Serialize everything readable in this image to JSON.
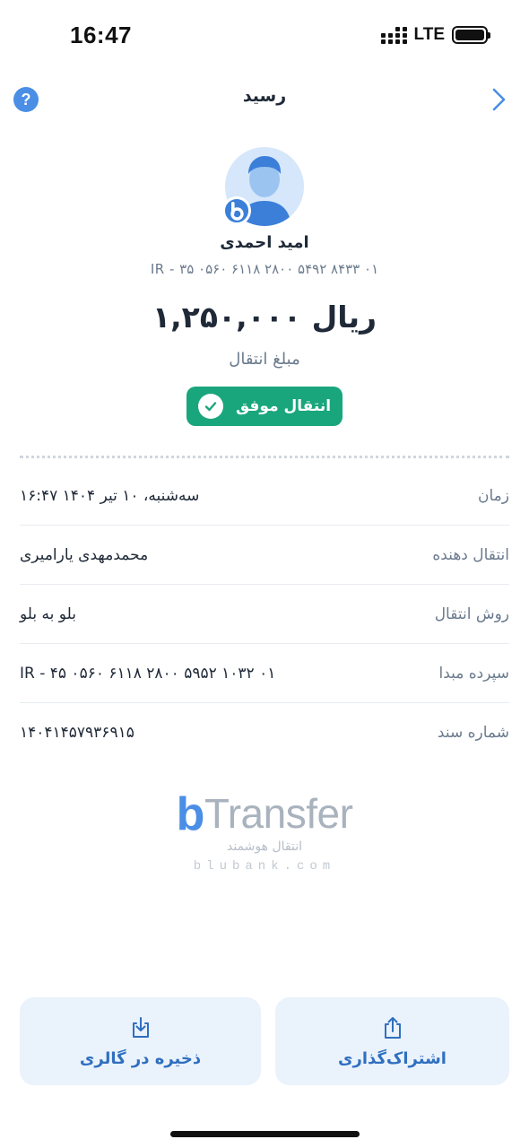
{
  "status_bar": {
    "time": "16:47",
    "network": "LTE"
  },
  "header": {
    "title": "رسید",
    "help_icon": "question-mark",
    "back_icon": "chevron-right"
  },
  "recipient": {
    "name": "امید احمدی",
    "iban": "IR - ۳۵ ۰۵۶۰ ۶۱۱۸ ۲۸۰۰ ۵۴۹۲ ۸۴۳۳ ۰۱"
  },
  "transfer": {
    "amount": "۱,۲۵۰,۰۰۰ ریال",
    "amount_label": "مبلغ انتقال",
    "status": "انتقال موفق"
  },
  "details": [
    {
      "label": "زمان",
      "value": "۱۶:۴۷ سه‌شنبه، ۱۰ تیر ۱۴۰۴"
    },
    {
      "label": "انتقال دهنده",
      "value": "محمدمهدی یارامیری"
    },
    {
      "label": "روش انتقال",
      "value": "بلو به بلو"
    },
    {
      "label": "سپرده مبدا",
      "value": "IR - ۴۵ ۰۵۶۰ ۶۱۱۸ ۲۸۰۰ ۵۹۵۲ ۱۰۳۲ ۰۱"
    },
    {
      "label": "شماره سند",
      "value": "۱۴۰۴۱۴۵۷۹۳۶۹۱۵"
    }
  ],
  "brand": {
    "logo_b": "b",
    "logo_text": "Transfer",
    "tagline": "انتقال هوشمند",
    "domain": "blubank.com"
  },
  "actions": {
    "save_label": "ذخیره در گالری",
    "share_label": "اشتراک‌گذاری"
  },
  "colors": {
    "accent": "#4a8ee6",
    "success": "#1aa67c",
    "button_bg": "#eaf2fc"
  }
}
